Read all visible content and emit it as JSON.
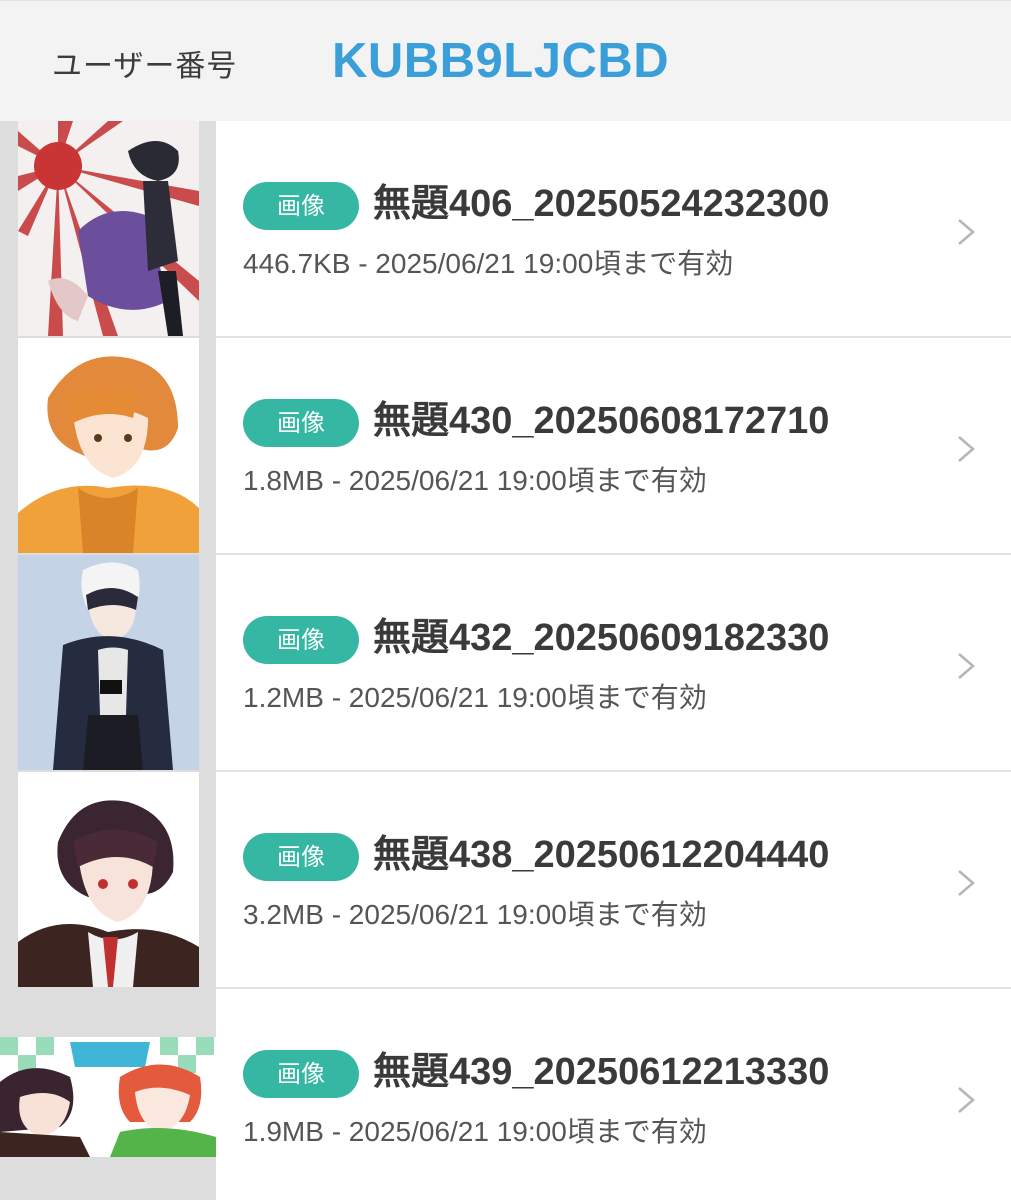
{
  "header": {
    "label": "ユーザー番号",
    "code": "KUBB9LJCBD"
  },
  "files": [
    {
      "badge": "画像",
      "title": "無題406_20250524232300",
      "meta": "446.7KB - 2025/06/21 19:00頃まで有効",
      "thumb": "sun-rays"
    },
    {
      "badge": "画像",
      "title": "無題430_20250608172710",
      "meta": "1.8MB - 2025/06/21 19:00頃まで有効",
      "thumb": "orange-hair"
    },
    {
      "badge": "画像",
      "title": "無題432_20250609182330",
      "meta": "1.2MB - 2025/06/21 19:00頃まで有効",
      "thumb": "dark-jacket"
    },
    {
      "badge": "画像",
      "title": "無題438_20250612204440",
      "meta": "3.2MB - 2025/06/21 19:00頃まで有効",
      "thumb": "dark-hair"
    },
    {
      "badge": "画像",
      "title": "無題439_20250612213330",
      "meta": "1.9MB - 2025/06/21 19:00頃まで有効",
      "thumb": "duo"
    }
  ],
  "colors": {
    "accent": "#3a9fd8",
    "badge": "#36b7a4"
  },
  "icons": {
    "chevron": "chevron-right-icon"
  }
}
